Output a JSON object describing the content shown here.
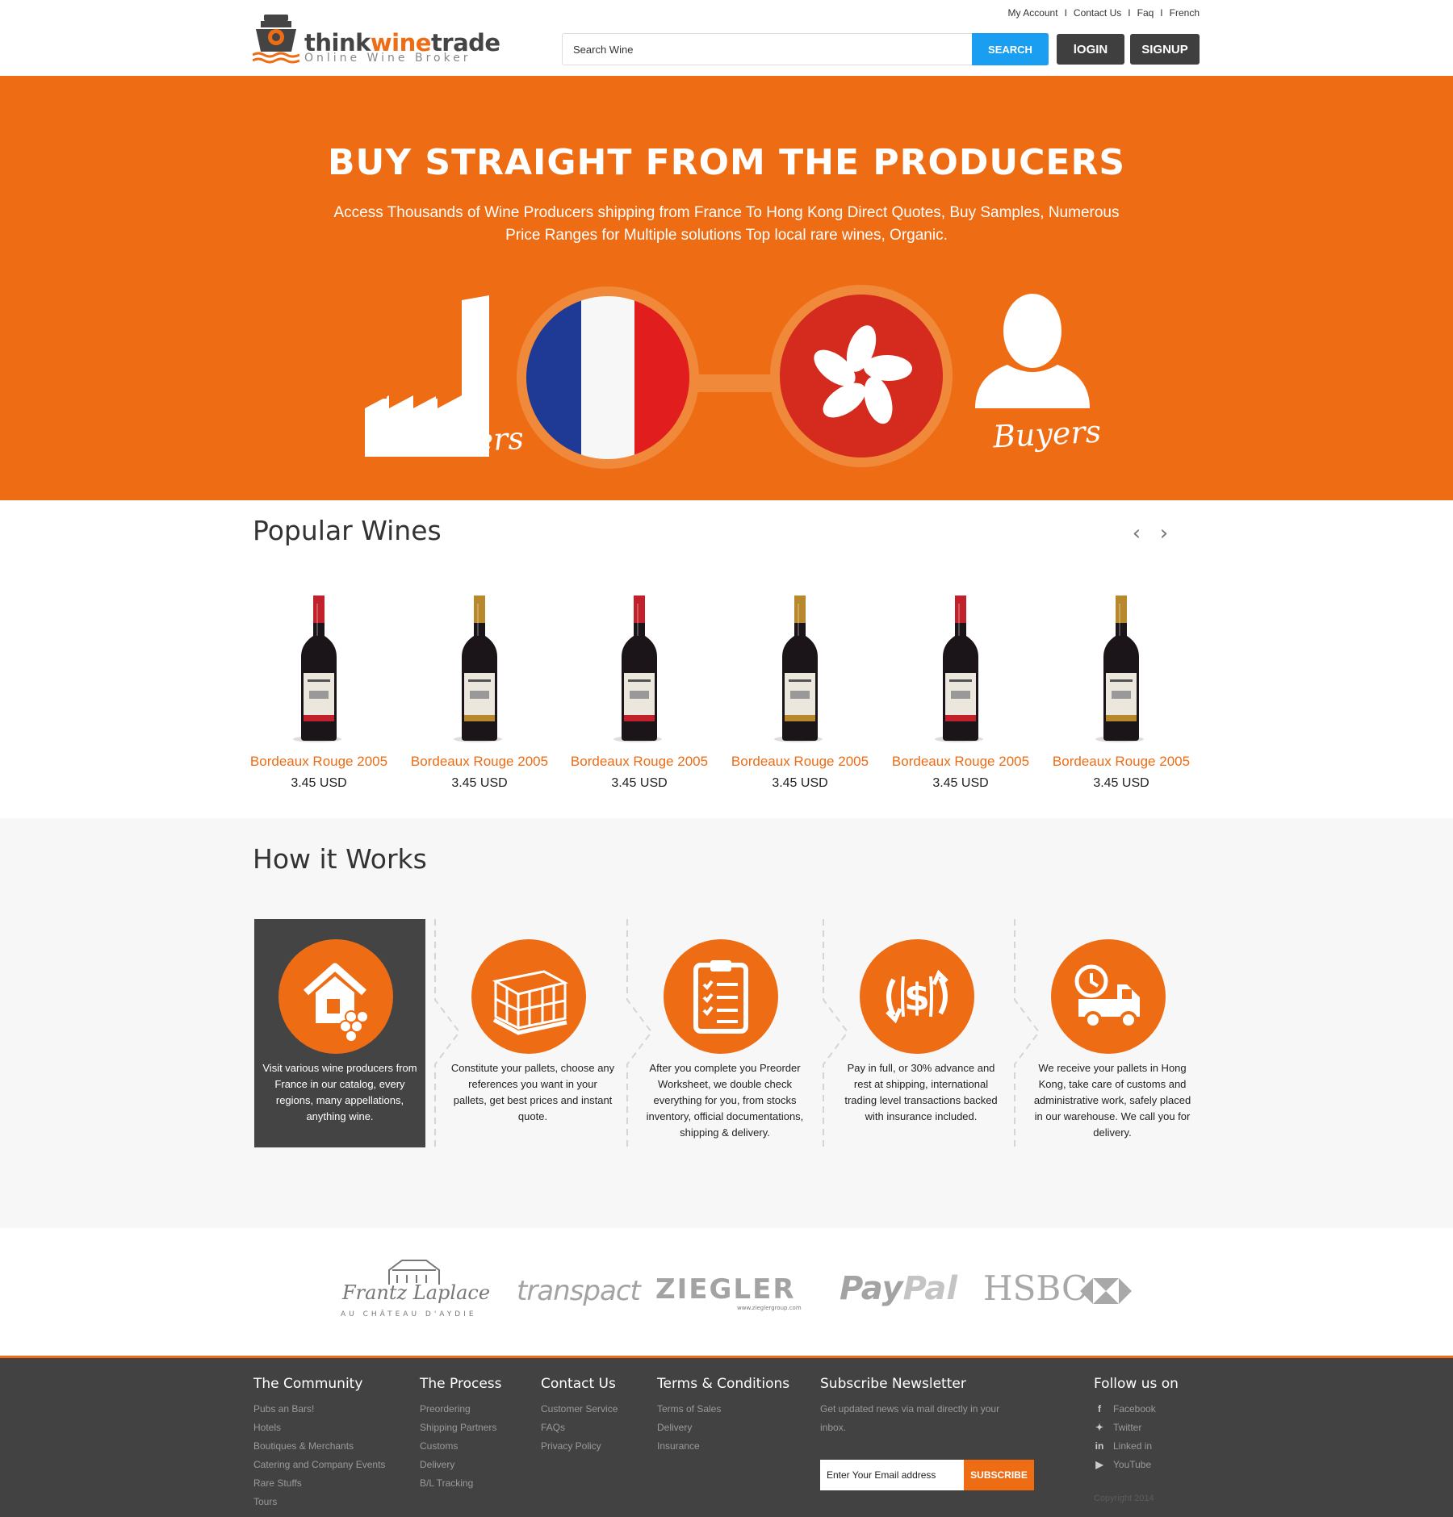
{
  "brand": {
    "name_part1": "think",
    "name_part2": "wine",
    "name_part3": "trade",
    "tagline": "Online Wine Broker"
  },
  "header": {
    "links": [
      "My Account",
      "Contact Us",
      "Faq",
      "French"
    ],
    "search_placeholder": "Search Wine",
    "search_button": "SEARCH",
    "login_button": "lOGIN",
    "signup_button": "SIGNUP"
  },
  "hero": {
    "title": "BUY STRAIGHT FROM THE PRODUCERS",
    "subtitle": "Access  Thousands of Wine Producers shipping from France To Hong Kong  Direct Quotes, Buy Samples, Numerous Price Ranges for Multiple solutions Top local rare wines, Organic.",
    "producers_label": "Producers",
    "buyers_label": "Buyers"
  },
  "popular": {
    "title": "Popular Wines",
    "wines": [
      {
        "name": "Bordeaux Rouge 2005",
        "price": "3.45 USD",
        "capsule": "#c0212b"
      },
      {
        "name": "Bordeaux Rouge 2005",
        "price": "3.45 USD",
        "capsule": "#b8892c"
      },
      {
        "name": "Bordeaux Rouge 2005",
        "price": "3.45 USD",
        "capsule": "#c0212b"
      },
      {
        "name": "Bordeaux Rouge 2005",
        "price": "3.45 USD",
        "capsule": "#b8892c"
      },
      {
        "name": "Bordeaux Rouge 2005",
        "price": "3.45 USD",
        "capsule": "#c0212b"
      },
      {
        "name": "Bordeaux Rouge 2005",
        "price": "3.45 USD",
        "capsule": "#b8892c"
      }
    ]
  },
  "how": {
    "title": "How it Works",
    "steps": [
      {
        "icon": "house-grapes-icon",
        "text": "Visit various wine producers from France in our catalog, every regions, many appellations, anything wine."
      },
      {
        "icon": "pallet-icon",
        "text": "Constitute your pallets, choose any references you want in your pallets, get best prices and instant quote."
      },
      {
        "icon": "clipboard-checklist-icon",
        "text": "After you complete you Preorder Worksheet, we double check everything for you, from stocks inventory, official documentations, shipping & delivery."
      },
      {
        "icon": "dollar-exchange-icon",
        "text": "Pay in full, or 30% advance and rest at shipping, international trading level transactions backed with insurance included."
      },
      {
        "icon": "delivery-truck-clock-icon",
        "text": "We receive your pallets in Hong Kong, take care of customs and administrative work, safely placed in our warehouse. We call you for delivery."
      }
    ]
  },
  "partners": {
    "laplace_line1": "Frantz Laplace",
    "laplace_line2": "AU CHÂTEAU D'AYDIE",
    "transpact": "transpact",
    "ziegler": "ZIEGLER",
    "ziegler_url": "www.zieglergroup.com",
    "paypal_1": "Pay",
    "paypal_2": "Pal",
    "hsbc": "HSBC"
  },
  "footer": {
    "community": {
      "title": "The Community",
      "items": [
        "Pubs an Bars!",
        "Hotels",
        "Boutiques & Merchants",
        "Catering and Company Events",
        "Rare Stuffs",
        "Tours"
      ]
    },
    "process": {
      "title": "The Process",
      "items": [
        "Preordering",
        "Shipping Partners",
        "Customs",
        "Delivery",
        "B/L Tracking"
      ]
    },
    "contact": {
      "title": "Contact Us",
      "items": [
        "Customer Service",
        "FAQs",
        "Privacy Policy"
      ]
    },
    "terms": {
      "title": "Terms & Conditions",
      "items": [
        "Terms of Sales",
        "Delivery",
        "Insurance"
      ]
    },
    "newsletter": {
      "title": "Subscribe Newsletter",
      "desc": "Get updated  news via mail directly in your inbox.",
      "email_placeholder": "Enter Your Email address",
      "button": "SUBSCRIBE"
    },
    "follow": {
      "title": "Follow us on",
      "items": [
        "Facebook",
        "Twitter",
        "Linked in",
        "YouTube"
      ]
    },
    "copyright": "Copyright 2014"
  },
  "colors": {
    "accent": "#ee6c14",
    "search_blue": "#1a9ef1",
    "dark": "#424242"
  }
}
